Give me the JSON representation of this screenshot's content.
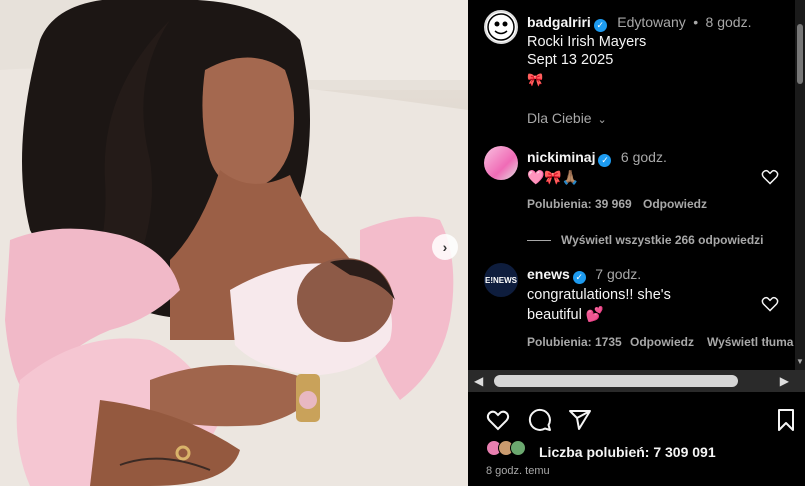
{
  "post": {
    "username": "badgalriri",
    "edited_label": "Edytowany",
    "separator": "•",
    "time_ago": "8 godz.",
    "caption_line1": "Rocki Irish Mayers",
    "caption_line2": "Sept 13 2025",
    "caption_emoji": "🎀",
    "filter_label": "Dla Ciebie"
  },
  "comments": [
    {
      "username": "nickiminaj",
      "time_ago": "6 godz.",
      "text": "🩷🎀🙏🏽",
      "likes_label": "Polubienia: 39 969",
      "reply_label": "Odpowiedz"
    },
    {
      "username": "enews",
      "time_ago": "7 godz.",
      "text_line1": "congratulations!! she's",
      "text_line2": "beautiful 💕",
      "likes_label": "Polubienia: 1735",
      "reply_label": "Odpowiedz",
      "translate_label": "Wyświetl tłuma"
    }
  ],
  "view_replies": "Wyświetl wszystkie 266 odpowiedzi",
  "footer": {
    "likes_label": "Liczba polubień: 7 309 091",
    "timestamp": "8 godz. temu"
  },
  "icons": {
    "like": "heart-icon",
    "comment": "comment-icon",
    "share": "share-icon",
    "save": "bookmark-icon"
  },
  "colors": {
    "background": "#000000",
    "verified": "#1d9bf0",
    "muted": "#a8a8a8"
  }
}
